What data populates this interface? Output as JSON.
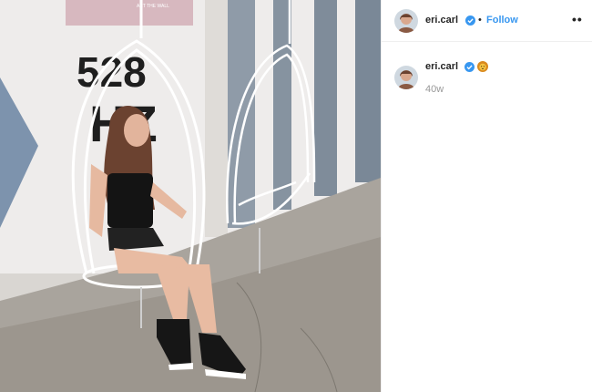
{
  "photo": {
    "sign_text": "ART THE WALL",
    "wall_numbers": "528",
    "wall_letters": "HZ"
  },
  "header": {
    "username": "eri.carl",
    "separator": "•",
    "follow_label": "Follow",
    "more_label": "••"
  },
  "caption": {
    "username": "eri.carl",
    "emoji": "lion-face-icon",
    "age": "40w"
  },
  "colors": {
    "link_blue": "#3897f0",
    "verified_blue": "#3897f0",
    "text_dark": "#262626",
    "muted": "#999999"
  }
}
